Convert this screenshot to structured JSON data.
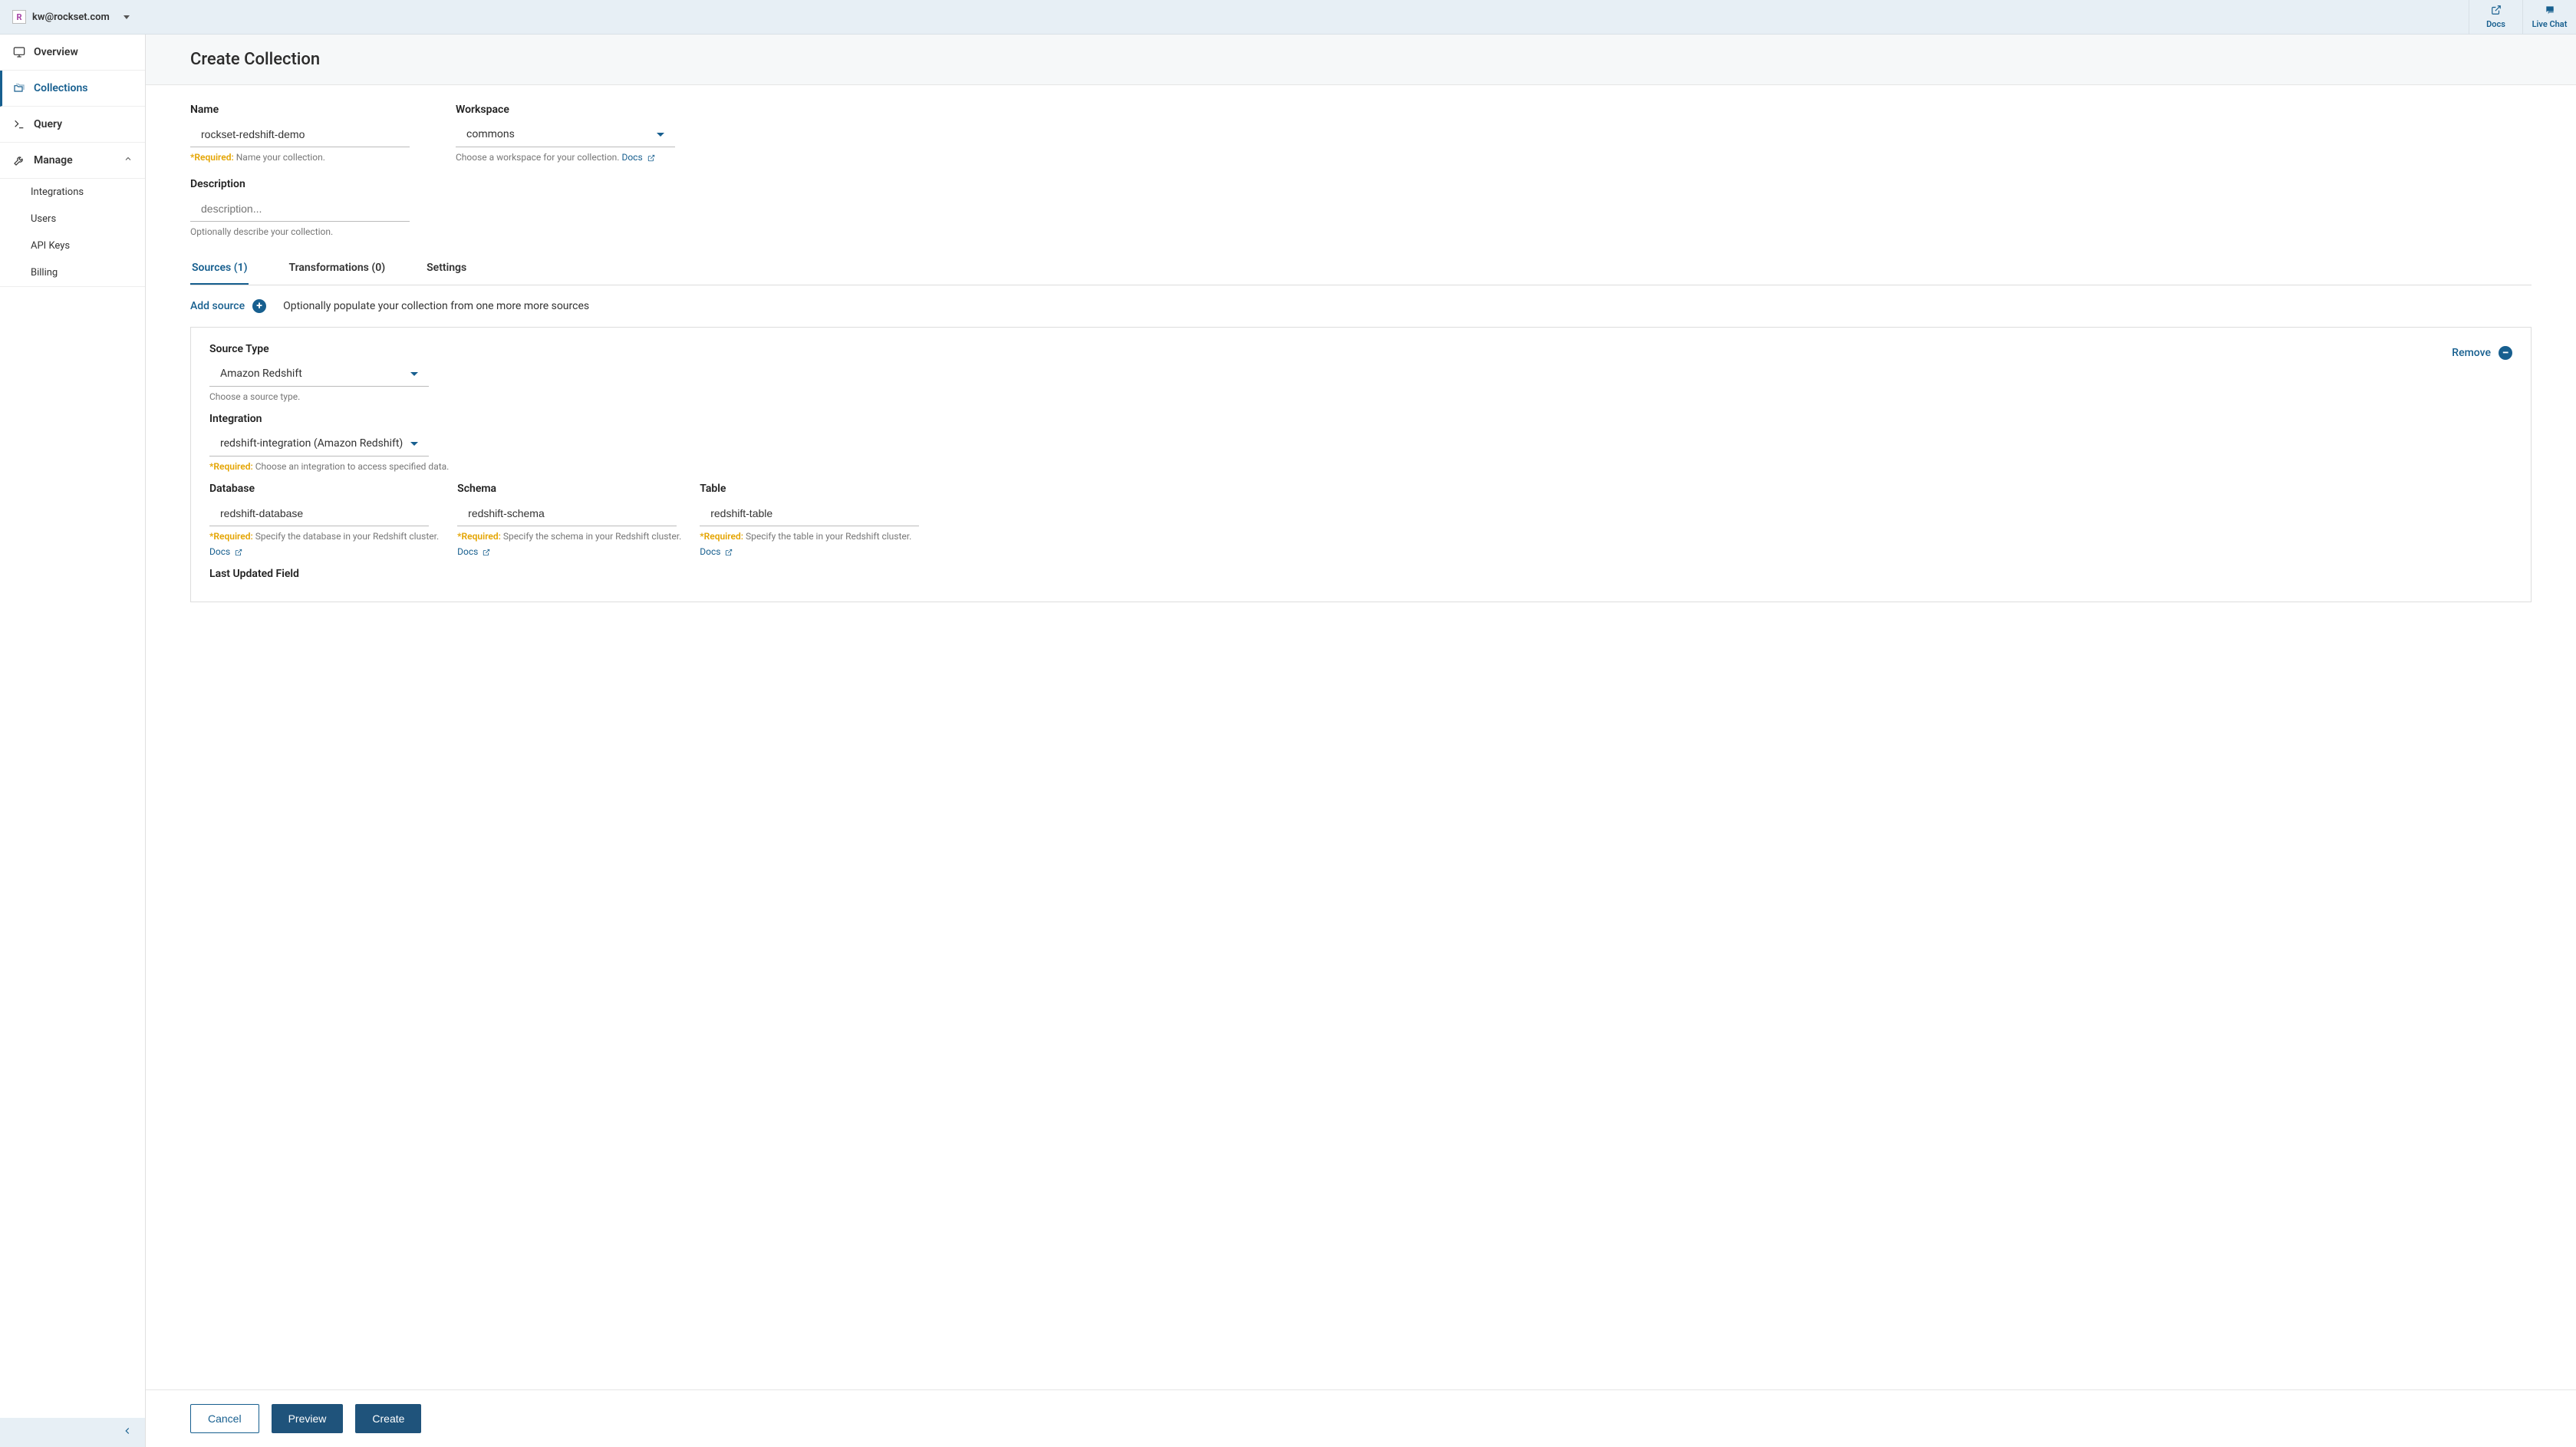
{
  "header": {
    "account_email": "kw@rockset.com",
    "docs_label": "Docs",
    "livechat_label": "Live Chat"
  },
  "sidebar": {
    "overview": "Overview",
    "collections": "Collections",
    "query": "Query",
    "manage": "Manage",
    "subitems": {
      "integrations": "Integrations",
      "users": "Users",
      "apikeys": "API Keys",
      "billing": "Billing"
    }
  },
  "page": {
    "title": "Create Collection"
  },
  "form": {
    "name_label": "Name",
    "name_value": "rockset-redshift-demo",
    "name_req": "*Required:",
    "name_help": "Name your collection.",
    "workspace_label": "Workspace",
    "workspace_value": "commons",
    "workspace_help": "Choose a workspace for your collection.",
    "workspace_docs": "Docs",
    "description_label": "Description",
    "description_placeholder": "description...",
    "description_help": "Optionally describe your collection."
  },
  "tabs": {
    "sources": "Sources (1)",
    "transformations": "Transformations (0)",
    "settings": "Settings"
  },
  "addsource": {
    "label": "Add source",
    "hint": "Optionally populate your collection from one more more sources"
  },
  "source": {
    "remove_label": "Remove",
    "type_label": "Source Type",
    "type_value": "Amazon Redshift",
    "type_help": "Choose a source type.",
    "integration_label": "Integration",
    "integration_value": "redshift-integration (Amazon Redshift)",
    "integration_req": "*Required:",
    "integration_help": "Choose an integration to access specified data.",
    "database_label": "Database",
    "database_value": "redshift-database",
    "database_req": "*Required:",
    "database_help": "Specify the database in your Redshift cluster.",
    "database_docs": "Docs",
    "schema_label": "Schema",
    "schema_value": "redshift-schema",
    "schema_req": "*Required:",
    "schema_help": "Specify the schema in your Redshift cluster.",
    "schema_docs": "Docs",
    "table_label": "Table",
    "table_value": "redshift-table",
    "table_req": "*Required:",
    "table_help": "Specify the table in your Redshift cluster.",
    "table_docs": "Docs",
    "last_updated_label": "Last Updated Field"
  },
  "footer": {
    "cancel": "Cancel",
    "preview": "Preview",
    "create": "Create"
  }
}
